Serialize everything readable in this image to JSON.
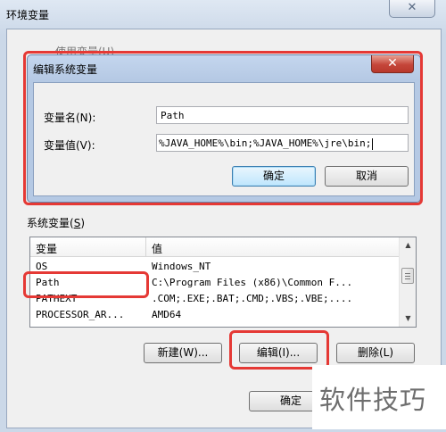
{
  "outer": {
    "title": "环境变量",
    "close_glyph": "✕",
    "behind_title_fragment": "使用变量(U)"
  },
  "edit_dialog": {
    "title": "编辑系统变量",
    "close_glyph": "✕",
    "name_label": "变量名(N):",
    "name_value": "Path",
    "value_label": "变量值(V):",
    "value_value": "%JAVA_HOME%\\bin;%JAVA_HOME%\\jre\\bin;",
    "ok_label": "确定",
    "cancel_label": "取消"
  },
  "system_vars": {
    "group_label": "系统变量(",
    "group_hotkey": "S",
    "group_label_end": ")",
    "columns": [
      "变量",
      "值"
    ],
    "rows": [
      {
        "name": "OS",
        "value": "Windows_NT"
      },
      {
        "name": "Path",
        "value": "C:\\Program Files (x86)\\Common F..."
      },
      {
        "name": "PATHEXT",
        "value": ".COM;.EXE;.BAT;.CMD;.VBS;.VBE;...."
      },
      {
        "name": "PROCESSOR_AR...",
        "value": "AMD64"
      }
    ],
    "new_label": "新建(W)...",
    "edit_label": "编辑(I)...",
    "delete_label": "删除(L)"
  },
  "bottom": {
    "ok_label": "确定"
  },
  "watermark": "软件技巧",
  "colors": {
    "highlight_red": "#e53935",
    "default_button_border": "#3c7fb1",
    "close_button_red": "#c5463a"
  },
  "icons": [
    "close-icon",
    "scroll-up-icon",
    "scroll-down-icon"
  ]
}
